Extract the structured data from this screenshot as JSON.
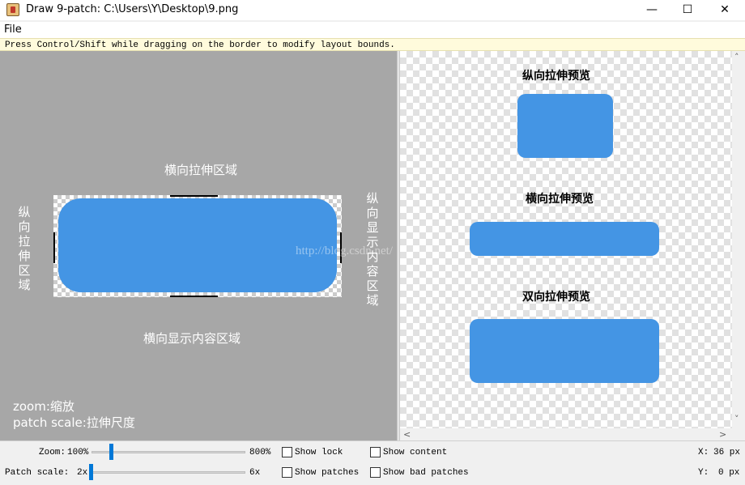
{
  "window": {
    "title": "Draw 9-patch: C:\\Users\\Y\\Desktop\\9.png",
    "controls": {
      "minimize": "—",
      "maximize": "☐",
      "close": "✕"
    }
  },
  "menu": {
    "file": "File"
  },
  "hint": "Press Control/Shift while dragging on the border to modify layout bounds.",
  "editor": {
    "label_top": "横向拉伸区域",
    "label_left": "纵向拉伸区域",
    "label_right": "纵向显示内容区域",
    "label_bottom": "横向显示内容区域",
    "watermark": "http://blog.csdn.net/",
    "legend_zoom": "zoom:缩放",
    "legend_patch_scale": "patch scale:拉伸尺度",
    "shape_color": "#4495e4"
  },
  "preview": {
    "vertical_title": "纵向拉伸预览",
    "horizontal_title": "横向拉伸预览",
    "both_title": "双向拉伸预览"
  },
  "scrollbars": {
    "up": "˄",
    "down": "˅",
    "left": "<",
    "right": ">"
  },
  "controls": {
    "zoom_label": "Zoom:",
    "zoom_min": "100%",
    "zoom_max": "800%",
    "zoom_value": 0.0,
    "patch_scale_label": "Patch scale:",
    "patch_scale_min": "2x",
    "patch_scale_max": "6x",
    "patch_scale_value": 0.0,
    "show_lock": "Show lock",
    "show_content": "Show content",
    "show_patches": "Show patches",
    "show_bad_patches": "Show bad patches",
    "x_label": "X:",
    "x_value": "36 px",
    "y_label": "Y:",
    "y_value": "0 px"
  }
}
